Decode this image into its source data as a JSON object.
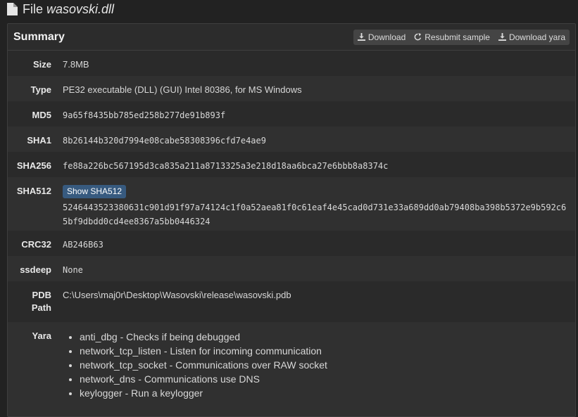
{
  "file": {
    "prefix": "File",
    "name": "wasovski.dll",
    "icon": "file-icon"
  },
  "summary": {
    "title": "Summary",
    "buttons": {
      "download": "Download",
      "resubmit": "Resubmit sample",
      "download_yara": "Download yara"
    },
    "rows": {
      "size": {
        "label": "Size",
        "value": "7.8MB"
      },
      "type": {
        "label": "Type",
        "value": "PE32 executable (DLL) (GUI) Intel 80386, for MS Windows"
      },
      "md5": {
        "label": "MD5",
        "value": "9a65f8435bb785ed258b277de91b893f"
      },
      "sha1": {
        "label": "SHA1",
        "value": "8b26144b320d7994e08cabe58308396cfd7e4ae9"
      },
      "sha256": {
        "label": "SHA256",
        "value": "fe88a226bc567195d3ca835a211a8713325a3e218d18aa6bca27e6bbb8a8374c"
      },
      "sha512": {
        "label": "SHA512",
        "button": "Show SHA512",
        "value": "5246443523380631c901d91f97a74124c1f0a52aea81f0c61eaf4e45cad0d731e33a689dd0ab79408ba398b5372e9b592c65bf9dbdd0cd4ee8367a5bb0446324"
      },
      "crc32": {
        "label": "CRC32",
        "value": "AB246B63"
      },
      "ssdeep": {
        "label": "ssdeep",
        "value": "None"
      },
      "pdb": {
        "label_line1": "PDB",
        "label_line2": "Path",
        "value": "C:\\Users\\maj0r\\Desktop\\Wasovski\\release\\wasovski.pdb"
      },
      "yara": {
        "label": "Yara",
        "items": [
          "anti_dbg - Checks if being debugged",
          "network_tcp_listen - Listen for incoming communication",
          "network_tcp_socket - Communications over RAW socket",
          "network_dns - Communications use DNS",
          "keylogger - Run a keylogger"
        ]
      }
    }
  }
}
